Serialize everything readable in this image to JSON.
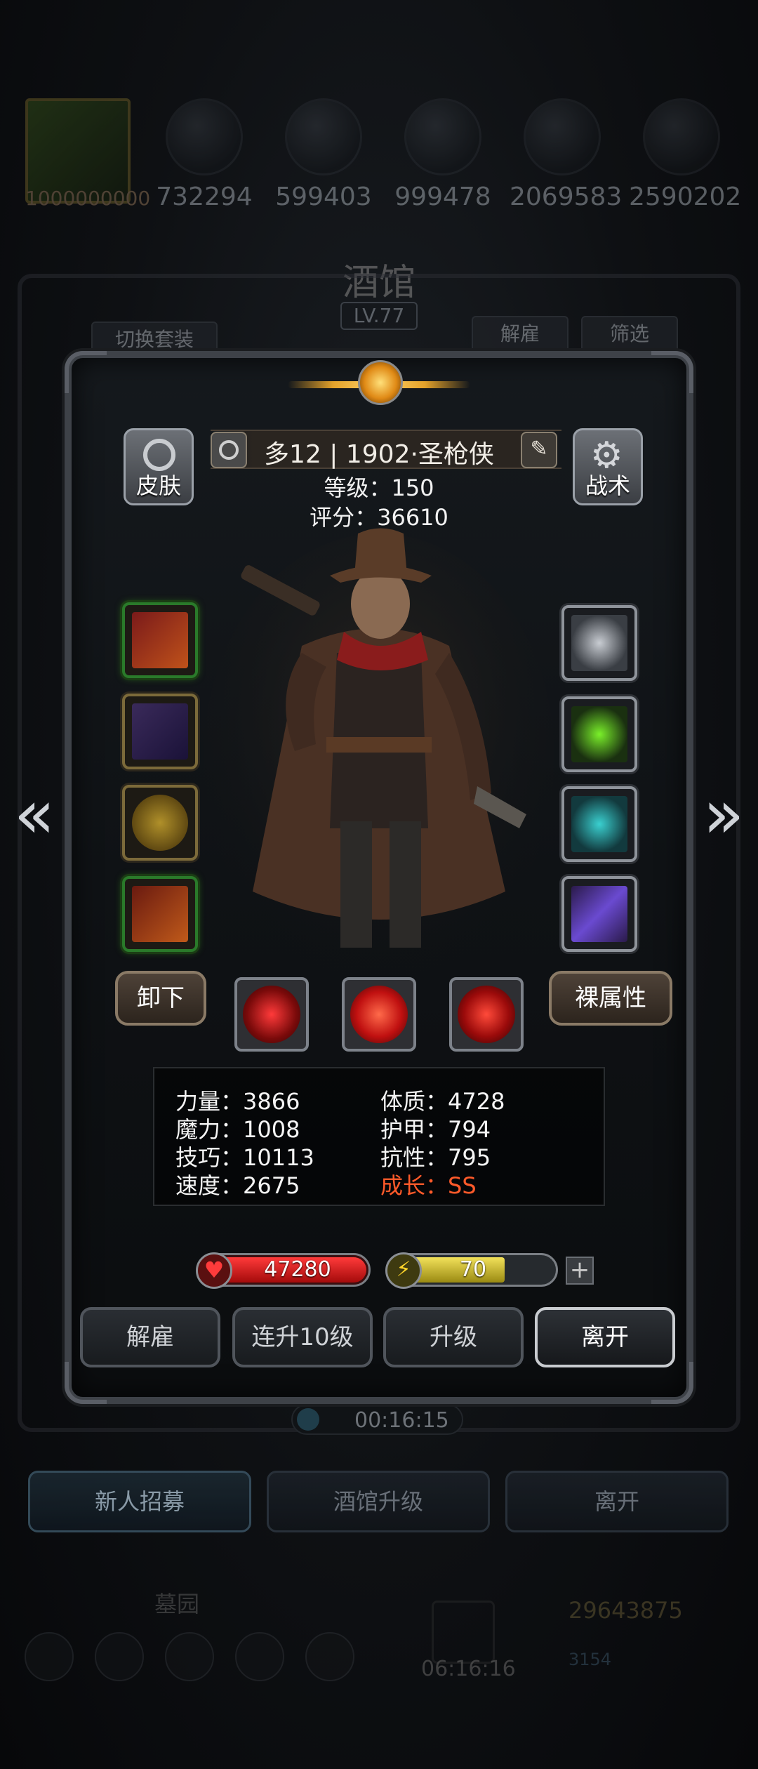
{
  "resources": [
    {
      "icon": "hero-portrait-icon",
      "value": "1000000000"
    },
    {
      "icon": "orange-orb-icon",
      "value": "732294"
    },
    {
      "icon": "wood-icon",
      "value": "599403"
    },
    {
      "icon": "stone-icon",
      "value": "999478"
    },
    {
      "icon": "crystal-icon",
      "value": "2069583"
    },
    {
      "icon": "iron-icon",
      "value": "2590202"
    }
  ],
  "tavern": {
    "title": "酒馆",
    "level": "LV.77"
  },
  "background_buttons": {
    "switch_set": "切换套装",
    "dismiss": "解雇",
    "filter": "筛选"
  },
  "hero": {
    "name": "多12 | 1902·圣枪侠",
    "level_text": "等级：150",
    "score_text": "评分：36610"
  },
  "corner_buttons": {
    "skin": "皮肤",
    "tactics": "战术"
  },
  "equipment_left": [
    {
      "icon": "golden-gun-icon",
      "rarity": "green"
    },
    {
      "icon": "armor-coat-icon",
      "rarity": "gold"
    },
    {
      "icon": "shield-icon",
      "rarity": "gold"
    },
    {
      "icon": "amulet-icon",
      "rarity": "green"
    }
  ],
  "equipment_right": [
    {
      "icon": "cloud-charm-icon",
      "rarity": "silver"
    },
    {
      "icon": "green-potion-icon",
      "rarity": "silver"
    },
    {
      "icon": "teal-stone-icon",
      "rarity": "silver"
    },
    {
      "icon": "purple-wand-icon",
      "rarity": "silver"
    }
  ],
  "skill_row": {
    "unequip": "卸下",
    "base_attributes": "裸属性"
  },
  "skills": [
    {
      "icon": "crosshair-skill-icon"
    },
    {
      "icon": "vortex-skill-icon"
    },
    {
      "icon": "target-skill-icon"
    }
  ],
  "stats": {
    "strength": "力量：3866",
    "magic": "魔力：1008",
    "skill": "技巧：10113",
    "speed": "速度：2675",
    "constitution": "体质：4728",
    "armor": "护甲：794",
    "resistance": "抗性：795",
    "growth": "成长：SS"
  },
  "hp": {
    "value": "47280",
    "fill_fraction": 1.0
  },
  "energy": {
    "value": "70",
    "fill_fraction": 0.7,
    "plus": "+"
  },
  "actions": {
    "dismiss": "解雇",
    "upgrade10": "连升10级",
    "upgrade": "升级",
    "leave": "离开"
  },
  "timer": "00:16:15",
  "bottom_buttons": {
    "recruit": "新人招募",
    "tavern_upgrade": "酒馆升级",
    "leave": "离开"
  },
  "bottom_bg": {
    "cemetery": "墓园",
    "gold": "29643875",
    "gem_timer": "06:16:16",
    "gem": "3154"
  },
  "colors": {
    "growth": "#ff5a2a",
    "hp": "#e01c1c",
    "energy": "#e8d43a",
    "gold_accent": "#e4a22a"
  }
}
